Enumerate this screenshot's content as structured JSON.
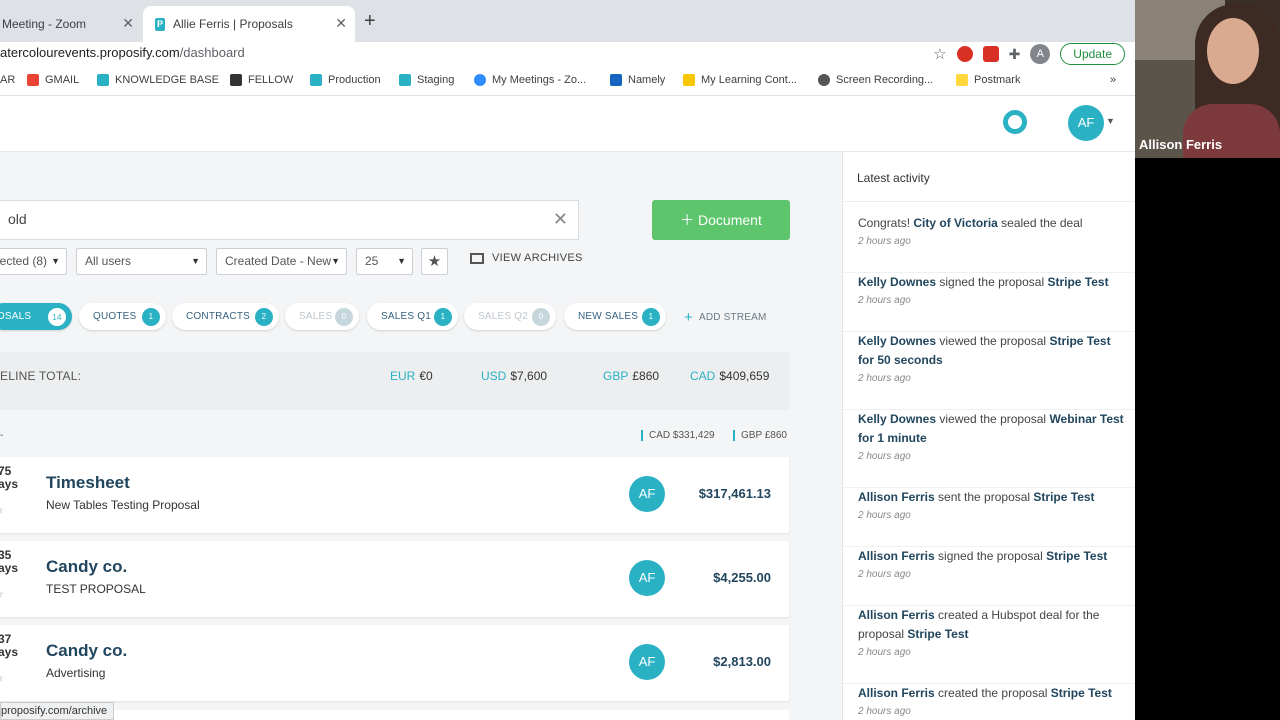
{
  "browser": {
    "tabs": [
      {
        "label": "Meeting - Zoom"
      },
      {
        "label": "Allie Ferris | Proposals"
      }
    ],
    "url_host": "atercolourevents.proposify.com",
    "url_path": "/dashboard",
    "update_label": "Update",
    "account_initial": "A",
    "bookmarks": [
      "AR",
      "GMAIL",
      "KNOWLEDGE BASE",
      "FELLOW",
      "Production",
      "Staging",
      "My Meetings - Zo...",
      "Namely",
      "My Learning Cont...",
      "Screen Recording...",
      "Postmark"
    ],
    "bookmarks_more": "»",
    "status_url": "proposify.com/archive"
  },
  "header": {
    "avatar_initials": "AF"
  },
  "toolbar": {
    "search_value": "old",
    "document_button": "Document",
    "filters": {
      "selected": "lected (8)",
      "users": "All users",
      "sort": "Created Date - New",
      "per_page": "25"
    },
    "view_archives": "VIEW ARCHIVES"
  },
  "streams": [
    {
      "label": "POSALS",
      "count": "14",
      "state": "active"
    },
    {
      "label": "QUOTES",
      "count": "1",
      "state": "normal"
    },
    {
      "label": "CONTRACTS",
      "count": "2",
      "state": "normal"
    },
    {
      "label": "SALES",
      "count": "0",
      "state": "muted"
    },
    {
      "label": "SALES Q1",
      "count": "1",
      "state": "normal"
    },
    {
      "label": "SALES Q2",
      "count": "0",
      "state": "muted"
    },
    {
      "label": "NEW SALES",
      "count": "1",
      "state": "normal"
    }
  ],
  "add_stream": "ADD STREAM",
  "pipeline": {
    "label": "ELINE TOTAL:",
    "currencies": [
      {
        "code": "EUR",
        "value": "€0"
      },
      {
        "code": "USD",
        "value": "$7,600"
      },
      {
        "code": "GBP",
        "value": "£860"
      },
      {
        "code": "CAD",
        "value": "$409,659"
      }
    ]
  },
  "subtotals": {
    "dash": "-",
    "items": [
      "CAD $331,429",
      "GBP £860"
    ]
  },
  "proposals": [
    {
      "days_num": "75",
      "days_unit": "ays",
      "title": "Timesheet",
      "subtitle": "New Tables Testing Proposal",
      "avatar": "AF",
      "amount": "$317,461.13"
    },
    {
      "days_num": "35",
      "days_unit": "ays",
      "title": "Candy co.",
      "subtitle": "TEST PROPOSAL",
      "avatar": "AF",
      "amount": "$4,255.00"
    },
    {
      "days_num": "37",
      "days_unit": "ays",
      "title": "Candy co.",
      "subtitle": "Advertising",
      "avatar": "AF",
      "amount": "$2,813.00"
    }
  ],
  "activity": {
    "title": "Latest activity",
    "items": [
      {
        "actor": "",
        "pre": "Congrats! ",
        "bold1": "City of Victoria",
        "mid": " sealed the deal",
        "bold2": "",
        "time": "2 hours ago"
      },
      {
        "actor": "Kelly Downes",
        "pre": " signed the proposal ",
        "bold1": "Stripe Test",
        "mid": "",
        "bold2": "",
        "time": "2 hours ago"
      },
      {
        "actor": "Kelly Downes",
        "pre": " viewed the proposal ",
        "bold1": "Stripe Test for 50 seconds",
        "mid": "",
        "bold2": "",
        "time": "2 hours ago"
      },
      {
        "actor": "Kelly Downes",
        "pre": " viewed the proposal ",
        "bold1": "Webinar Test for 1 minute",
        "mid": "",
        "bold2": "",
        "time": "2 hours ago"
      },
      {
        "actor": "Allison Ferris",
        "pre": " sent the proposal ",
        "bold1": "Stripe Test",
        "mid": "",
        "bold2": "",
        "time": "2 hours ago"
      },
      {
        "actor": "Allison Ferris",
        "pre": " signed the proposal ",
        "bold1": "Stripe Test",
        "mid": "",
        "bold2": "",
        "time": "2 hours ago"
      },
      {
        "actor": "Allison Ferris",
        "pre": " created a Hubspot deal for the proposal ",
        "bold1": "Stripe Test",
        "mid": "",
        "bold2": "",
        "time": "2 hours ago"
      },
      {
        "actor": "Allison Ferris",
        "pre": " created the proposal ",
        "bold1": "Stripe Test",
        "mid": "",
        "bold2": "",
        "time": "2 hours ago"
      }
    ]
  },
  "video": {
    "participant_name": "Allison Ferris"
  },
  "colors": {
    "accent": "#2ab1c4",
    "document_button": "#5dc56b",
    "heading": "#21465d"
  }
}
